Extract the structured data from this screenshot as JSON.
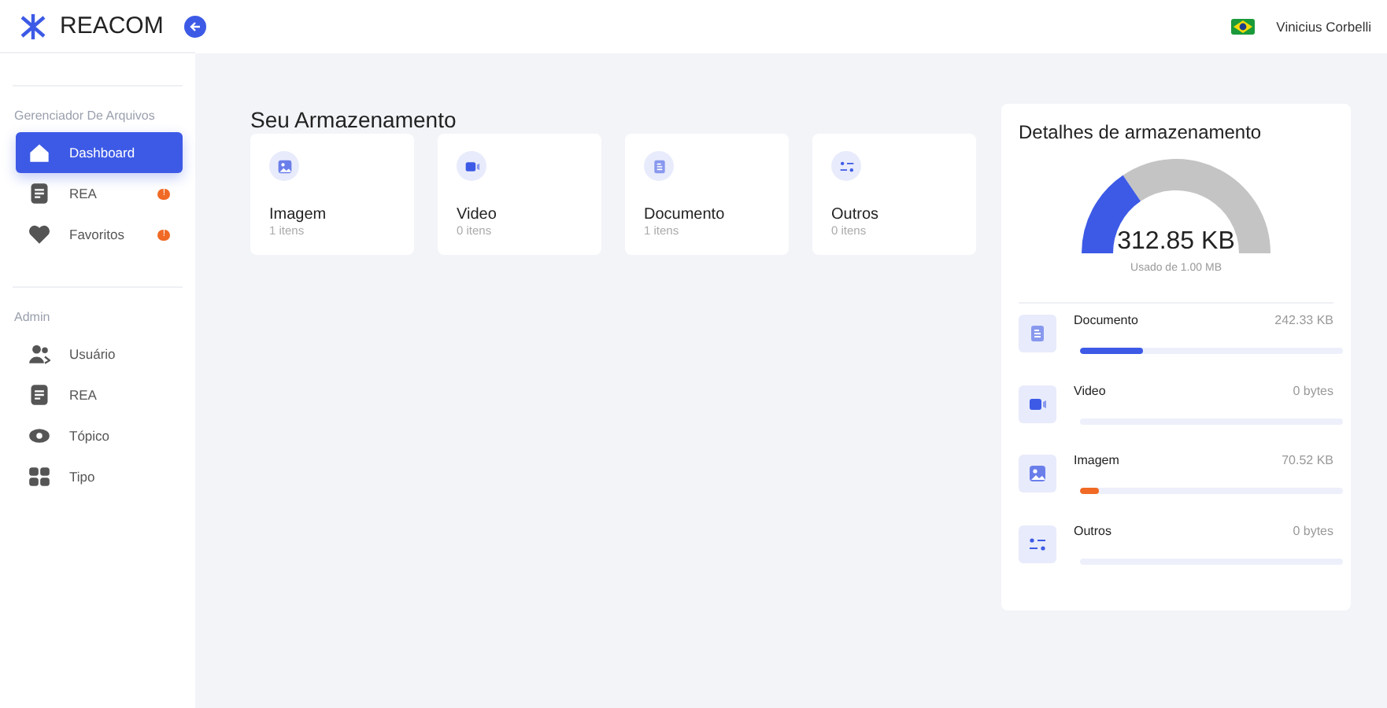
{
  "brand": {
    "name": "REACOM"
  },
  "user": {
    "name": "Vinicius Corbelli"
  },
  "sidebar": {
    "sections": [
      {
        "title": "Gerenciador De Arquivos",
        "items": [
          {
            "label": "Dashboard",
            "selected": true
          },
          {
            "label": "REA",
            "selected": false,
            "badge": "!"
          },
          {
            "label": "Favoritos",
            "selected": false,
            "badge": "!"
          }
        ]
      },
      {
        "title": "Admin",
        "items": [
          {
            "label": "Usuário",
            "selected": false
          },
          {
            "label": "REA",
            "selected": false
          },
          {
            "label": "Tópico",
            "selected": false
          },
          {
            "label": "Tipo",
            "selected": false
          }
        ]
      }
    ]
  },
  "storage": {
    "title": "Seu Armazenamento",
    "cards": [
      {
        "name": "Imagem",
        "count": "1 itens"
      },
      {
        "name": "Video",
        "count": "0 itens"
      },
      {
        "name": "Documento",
        "count": "1 itens"
      },
      {
        "name": "Outros",
        "count": "0 itens"
      }
    ]
  },
  "details": {
    "title": "Detalhes de armazenamento",
    "gauge": {
      "value": "312.85 KB",
      "caption": "Usado de 1.00 MB"
    },
    "rows": [
      {
        "name": "Documento",
        "size": "242.33 KB",
        "level": 0.24,
        "color": "#3d5ae6"
      },
      {
        "name": "Video",
        "size": "0 bytes",
        "level": 0
      },
      {
        "name": "Imagem",
        "size": "70.52 KB",
        "level": 0.07,
        "color": "#f06a25"
      },
      {
        "name": "Outros",
        "size": "0 bytes",
        "level": 0
      }
    ]
  }
}
